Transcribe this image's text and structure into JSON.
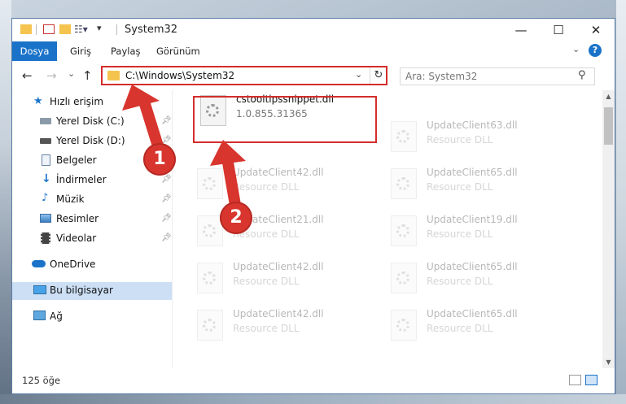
{
  "window": {
    "title": "System32",
    "controls": {
      "minimize": "—",
      "maximize": "☐",
      "close": "✕"
    }
  },
  "ribbon": {
    "tabs": [
      "Dosya",
      "Giriş",
      "Paylaş",
      "Görünüm"
    ],
    "help": "?"
  },
  "navigation": {
    "back": "←",
    "forward": "→",
    "recent": "⌄",
    "up": "↑",
    "address": "C:\\Windows\\System32",
    "search_placeholder": "Ara: System32"
  },
  "sidebar": {
    "items": [
      {
        "label": "Hızlı erişim",
        "icon": "star-icon",
        "pinned": false
      },
      {
        "label": "Yerel Disk (C:)",
        "icon": "drive-icon",
        "pinned": true
      },
      {
        "label": "Yerel Disk (D:)",
        "icon": "drive-icon",
        "pinned": true
      },
      {
        "label": "Belgeler",
        "icon": "document-icon",
        "pinned": true
      },
      {
        "label": "İndirmeler",
        "icon": "download-icon",
        "pinned": true
      },
      {
        "label": "Müzik",
        "icon": "music-icon",
        "pinned": true
      },
      {
        "label": "Resimler",
        "icon": "picture-icon",
        "pinned": true
      },
      {
        "label": "Videolar",
        "icon": "video-icon",
        "pinned": true
      },
      {
        "label": "OneDrive",
        "icon": "cloud-icon",
        "pinned": false
      },
      {
        "label": "Bu bilgisayar",
        "icon": "computer-icon",
        "pinned": false
      },
      {
        "label": "Ağ",
        "icon": "network-icon",
        "pinned": false
      }
    ],
    "selected": "Bu bilgisayar"
  },
  "files": {
    "highlighted": {
      "name": "cstooltipssnippet.dll",
      "detail": "1.0.855.31365"
    },
    "left_column": [
      {
        "name": "UpdateClient42.dll",
        "detail": "Resource DLL"
      },
      {
        "name": "UpdateClient21.dll",
        "detail": "Resource DLL"
      },
      {
        "name": "UpdateClient42.dll",
        "detail": "Resource DLL"
      },
      {
        "name": "UpdateClient42.dll",
        "detail": "Resource DLL"
      }
    ],
    "right_column": [
      {
        "name": "UpdateClient63.dll",
        "detail": "Resource DLL"
      },
      {
        "name": "UpdateClient65.dll",
        "detail": "Resource DLL"
      },
      {
        "name": "UpdateClient19.dll",
        "detail": "Resource DLL"
      },
      {
        "name": "UpdateClient65.dll",
        "detail": "Resource DLL"
      },
      {
        "name": "UpdateClient65.dll",
        "detail": "Resource DLL"
      }
    ]
  },
  "status": {
    "item_count": "125 öğe"
  },
  "annotations": {
    "step1": "1",
    "step2": "2"
  },
  "colors": {
    "accent": "#1a73c9",
    "highlight": "#d42d2d",
    "selection": "#ccdff5"
  }
}
